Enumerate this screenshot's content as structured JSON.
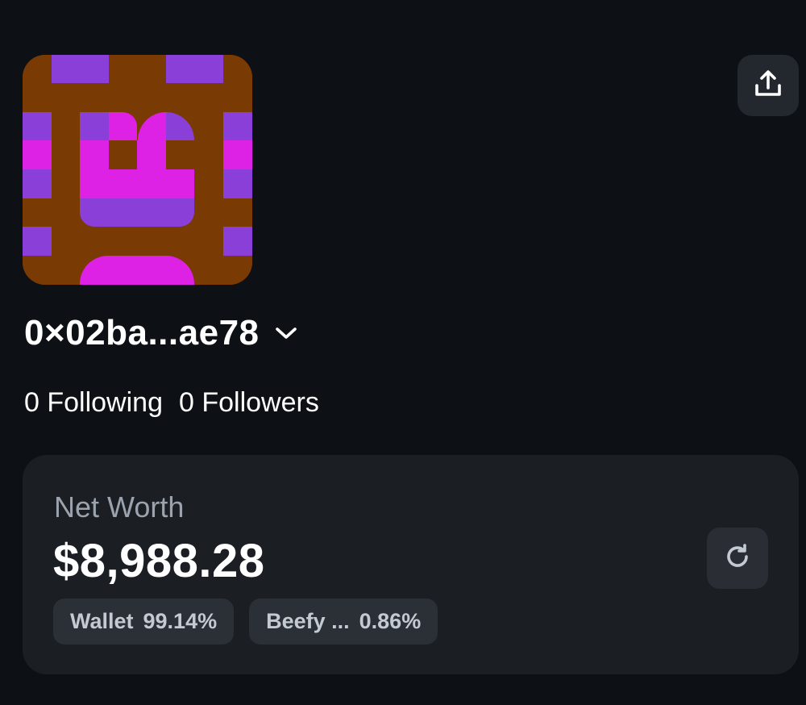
{
  "profile": {
    "avatar_colors": {
      "background": "#7a3a04",
      "purple": "#8a3fd8",
      "magenta": "#dd22e6"
    },
    "address": "0×02ba...ae78",
    "following": "0 Following",
    "followers": "0 Followers"
  },
  "icons": {
    "share": "share-upload-icon",
    "chevron": "chevron-down-icon",
    "refresh": "refresh-icon"
  },
  "net_worth": {
    "label": "Net Worth",
    "value": "$8,988.28",
    "breakdown": [
      {
        "name": "Wallet",
        "percent": "99.14%"
      },
      {
        "name": "Beefy ...",
        "percent": "0.86%"
      }
    ]
  }
}
